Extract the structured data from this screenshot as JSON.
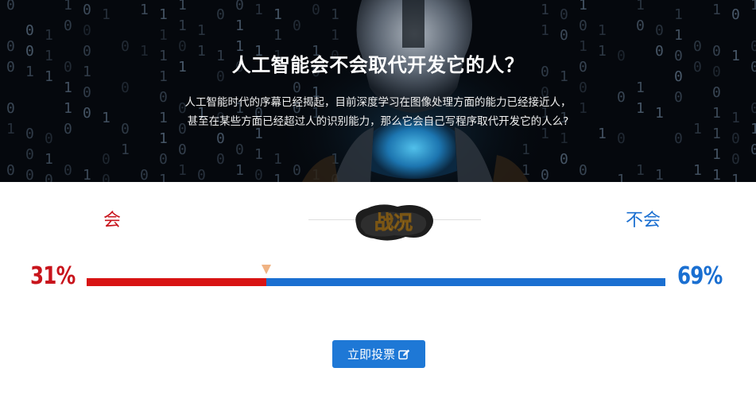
{
  "hero": {
    "title": "人工智能会不会取代开发它的人？",
    "description_lines": [
      "人工智能时代的序幕已经揭起，目前深度学习在图像处理方面的能力已经接近人，",
      "甚至在某些方面已经超过人的识别能力，那么它会自己写程序取代开发它的人么?"
    ]
  },
  "vote": {
    "yes_label": "会",
    "no_label": "不会",
    "badge_text": "战况",
    "yes_percent_text": "31%",
    "no_percent_text": "69%",
    "yes_fraction": 0.31,
    "button_label": "立即投票",
    "button_icon": "edit-icon"
  },
  "colors": {
    "yes": "#c8141c",
    "no": "#1a6fd1",
    "button": "#1e78d6",
    "marker": "#f0b383"
  }
}
